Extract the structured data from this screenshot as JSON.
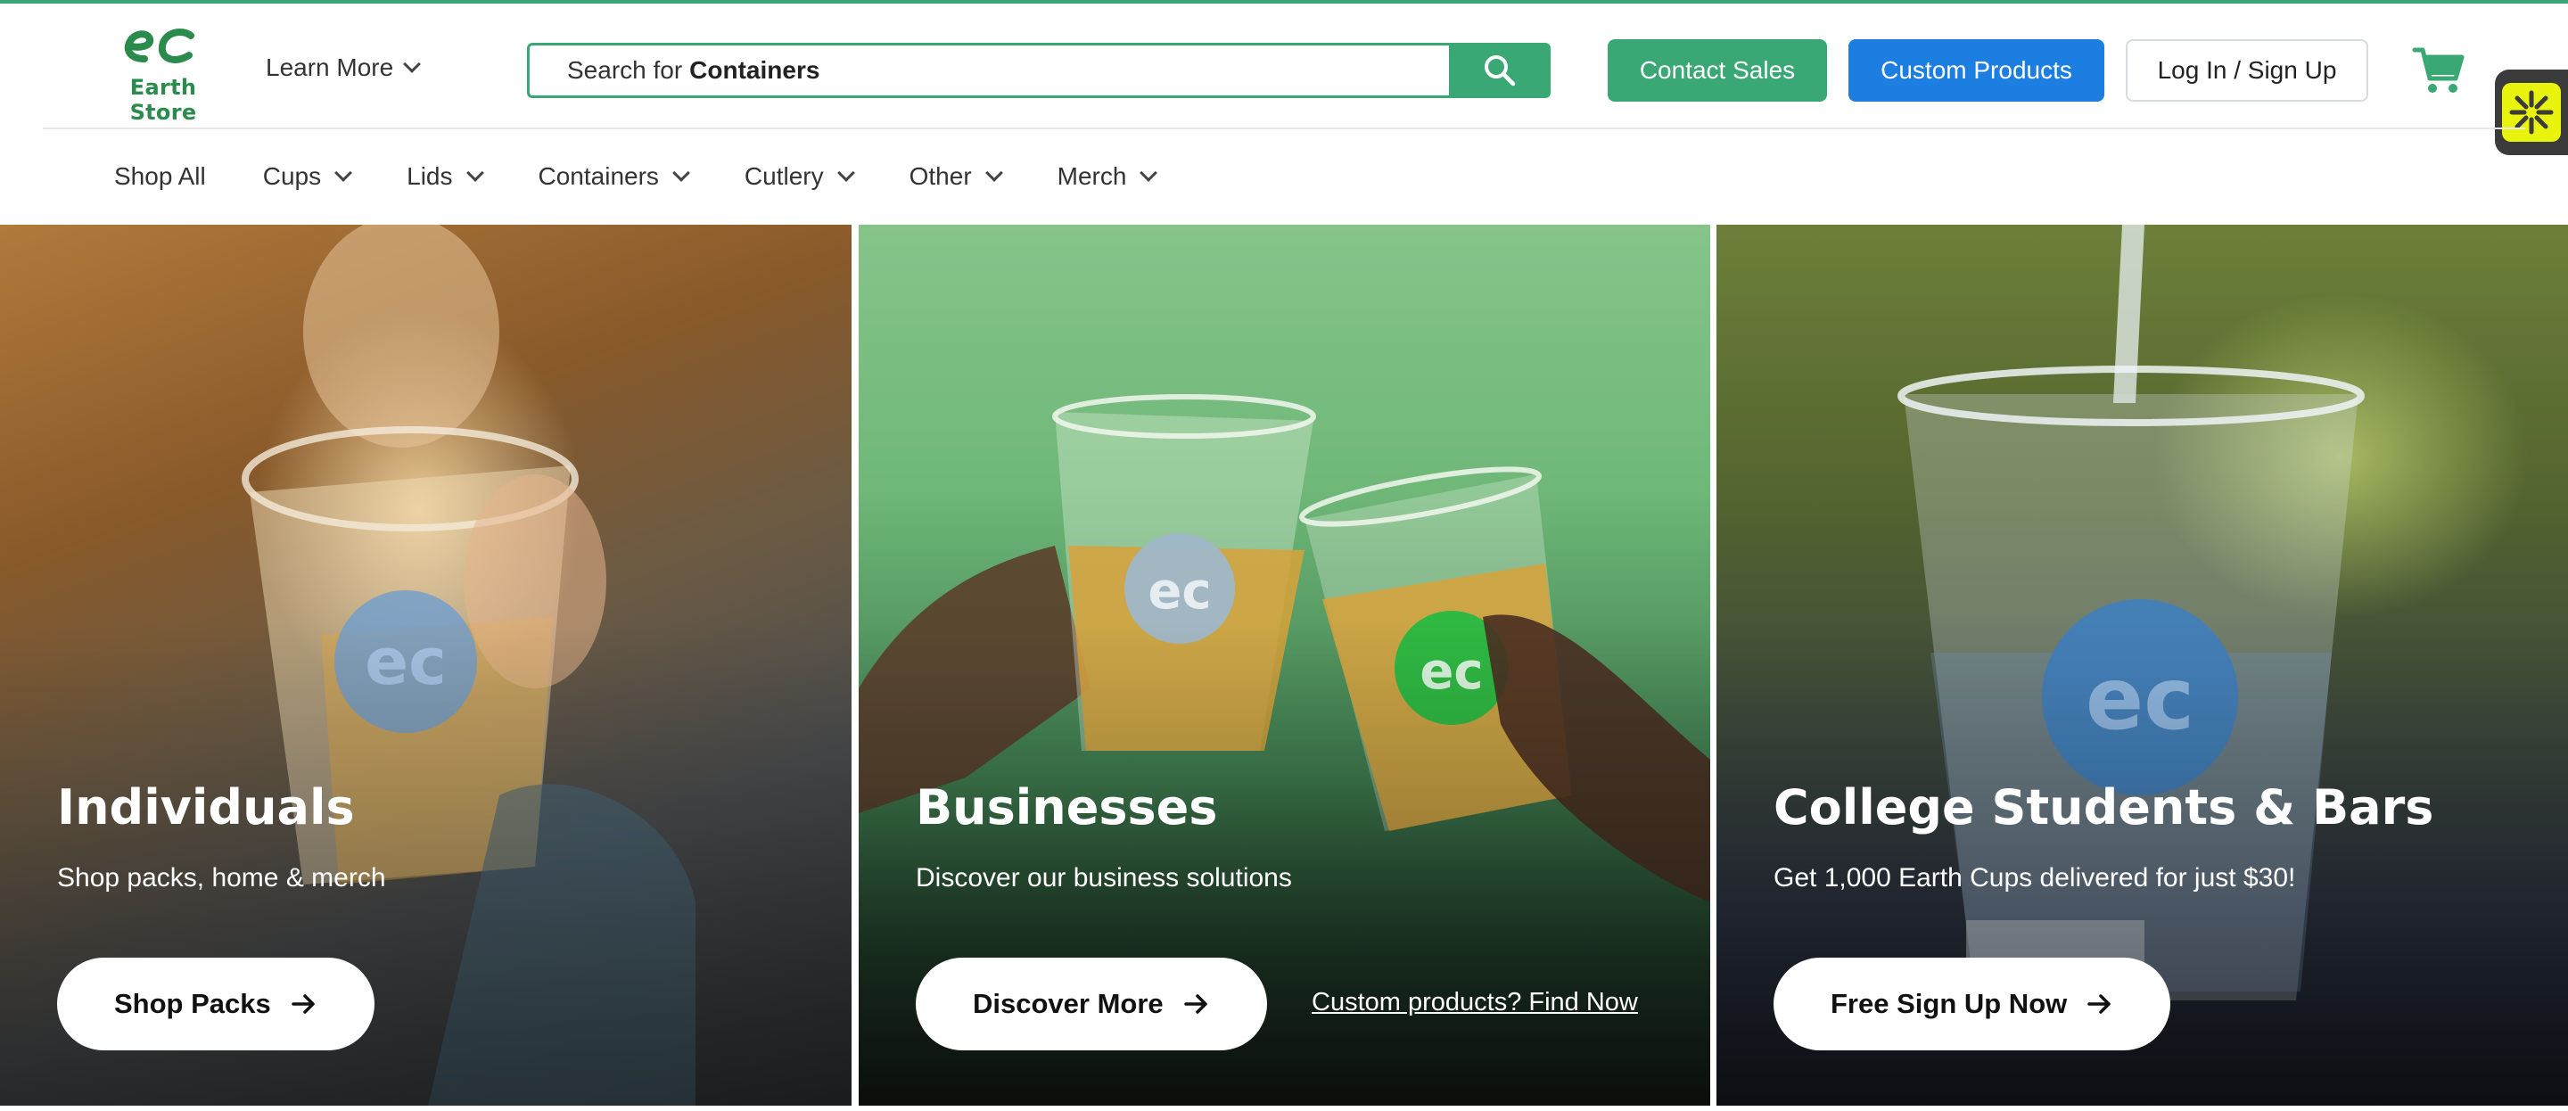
{
  "brand": {
    "logo_text": "Earth Store",
    "accent": "#3aa874",
    "blue": "#1c7ee0"
  },
  "header": {
    "learn_more": "Learn More",
    "search": {
      "prefix": "Search for",
      "term": "Containers"
    },
    "contact_sales": "Contact Sales",
    "custom_products": "Custom Products",
    "login": "Log In / Sign Up"
  },
  "nav": {
    "items": [
      {
        "label": "Shop All",
        "dropdown": false
      },
      {
        "label": "Cups",
        "dropdown": true
      },
      {
        "label": "Lids",
        "dropdown": true
      },
      {
        "label": "Containers",
        "dropdown": true
      },
      {
        "label": "Cutlery",
        "dropdown": true
      },
      {
        "label": "Other",
        "dropdown": true
      },
      {
        "label": "Merch",
        "dropdown": true
      }
    ]
  },
  "panels": [
    {
      "title": "Individuals",
      "subtitle": "Shop packs, home & merch",
      "cta": "Shop Packs"
    },
    {
      "title": "Businesses",
      "subtitle": "Discover our business solutions",
      "cta": "Discover More",
      "link": "Custom products? Find Now"
    },
    {
      "title": "College Students & Bars",
      "subtitle": "Get 1,000 Earth Cups delivered for just $30!",
      "cta": "Free Sign Up Now"
    }
  ],
  "icons": [
    "search-icon",
    "cart-icon",
    "accessibility-icon",
    "chevron-down-icon",
    "arrow-right-icon"
  ]
}
